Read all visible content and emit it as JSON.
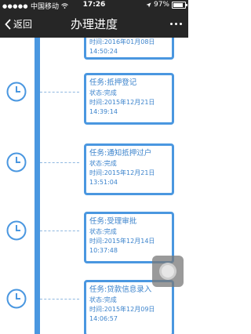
{
  "status_bar": {
    "carrier": "中国移动",
    "time": "17:26",
    "battery": "97%"
  },
  "nav": {
    "back_label": "返回",
    "title": "办理进度"
  },
  "timeline": {
    "partial_item": {
      "time_label": "时间:2016年01月08日",
      "time_clock": "14:50:24"
    },
    "items": [
      {
        "task": "任务:抵押登记",
        "status": "状态:完成",
        "time_label": "时间:2015年12月21日",
        "time_clock": "14:39:14"
      },
      {
        "task": "任务:通知抵押过户",
        "status": "状态:完成",
        "time_label": "时间:2015年12月21日",
        "time_clock": "13:51:04"
      },
      {
        "task": "任务:受理审批",
        "status": "状态:完成",
        "time_label": "时间:2015年12月14日",
        "time_clock": "10:37:48"
      },
      {
        "task": "任务:贷款信息录入",
        "status": "状态:完成",
        "time_label": "时间:2015年12月09日",
        "time_clock": "14:06:57"
      }
    ]
  },
  "colors": {
    "accent": "#4a97e0",
    "nav_background": "#262626"
  }
}
